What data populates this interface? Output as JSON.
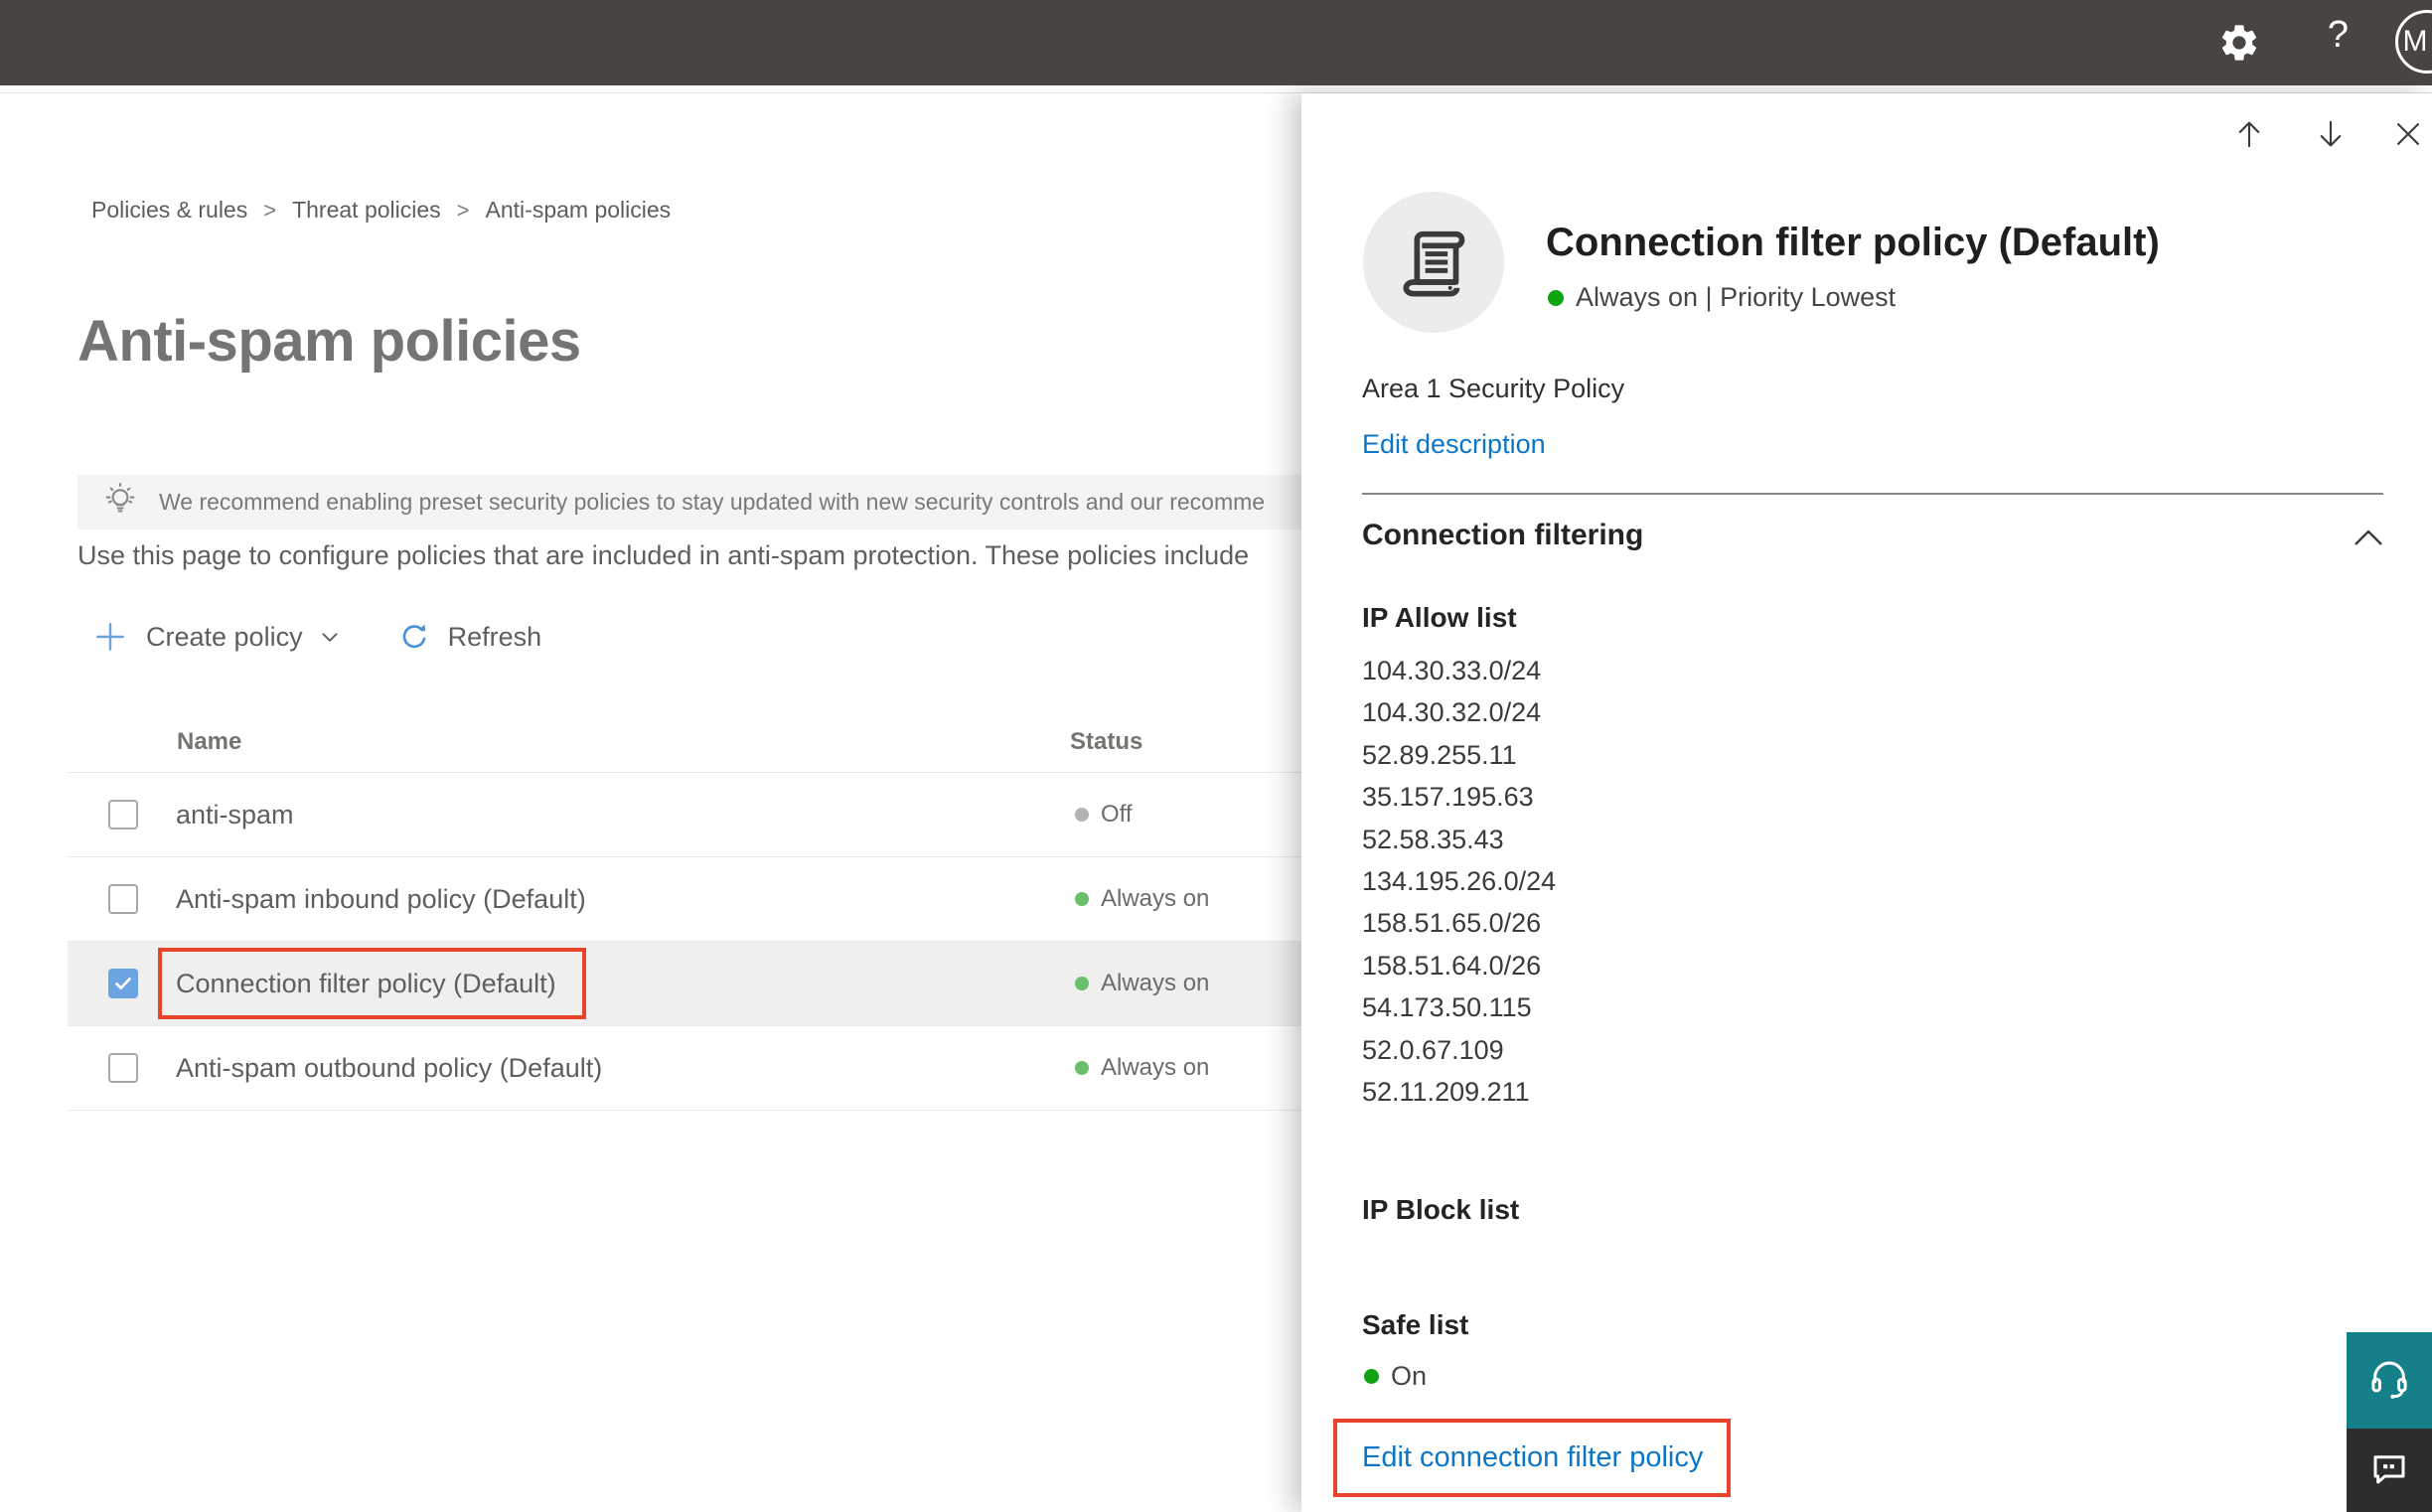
{
  "topbar": {
    "help_label": "?",
    "avatar_initial": "M"
  },
  "breadcrumb": {
    "separator": ">",
    "items": [
      "Policies & rules",
      "Threat policies",
      "Anti-spam policies"
    ]
  },
  "page": {
    "title": "Anti-spam policies",
    "banner_text": "We recommend enabling preset security policies to stay updated with new security controls and our recomme",
    "description": "Use this page to configure policies that are included in anti-spam protection. These policies include",
    "toolbar": {
      "create_policy_label": "Create policy",
      "refresh_label": "Refresh"
    },
    "table": {
      "columns": [
        "Name",
        "Status"
      ],
      "rows": [
        {
          "name": "anti-spam",
          "status": "Off",
          "status_color": "#b5b3b1",
          "checked": false,
          "selected": false,
          "annotated": false
        },
        {
          "name": "Anti-spam inbound policy (Default)",
          "status": "Always on",
          "status_color": "#6abf6a",
          "checked": false,
          "selected": false,
          "annotated": false
        },
        {
          "name": "Connection filter policy (Default)",
          "status": "Always on",
          "status_color": "#6abf6a",
          "checked": true,
          "selected": true,
          "annotated": true
        },
        {
          "name": "Anti-spam outbound policy (Default)",
          "status": "Always on",
          "status_color": "#6abf6a",
          "checked": false,
          "selected": false,
          "annotated": false
        }
      ]
    }
  },
  "panel": {
    "title": "Connection filter policy (Default)",
    "status_line": "Always on | Priority Lowest",
    "status_color": "#10a310",
    "description": "Area 1 Security Policy",
    "edit_description_label": "Edit description",
    "section_title": "Connection filtering",
    "ip_allow": {
      "title": "IP Allow list",
      "entries": [
        "104.30.33.0/24",
        "104.30.32.0/24",
        "52.89.255.11",
        "35.157.195.63",
        "52.58.35.43",
        "134.195.26.0/24",
        "158.51.65.0/26",
        "158.51.64.0/26",
        "54.173.50.115",
        "52.0.67.109",
        "52.11.209.211"
      ]
    },
    "ip_block": {
      "title": "IP Block list"
    },
    "safe_list": {
      "title": "Safe list",
      "status": "On",
      "status_color": "#10a310"
    },
    "edit_link_label": "Edit connection filter policy"
  },
  "colors": {
    "accent_blue": "#0b76c8",
    "annotation_red": "#e8432b",
    "checkbox_blue": "#6ba4e0",
    "status_green_table": "#6abf6a",
    "status_green_panel": "#10a310",
    "status_off_gray": "#b5b3b1",
    "support_teal": "#15808a",
    "topbar_gray": "#474442"
  }
}
